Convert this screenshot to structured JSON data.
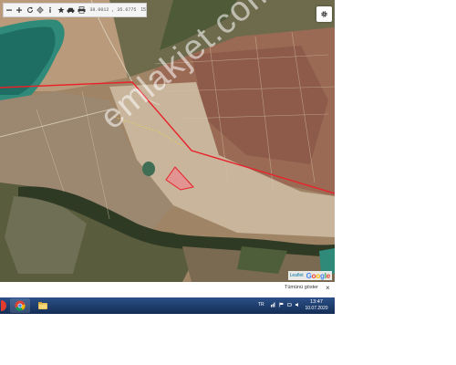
{
  "toolbar": {
    "coordinates": "38.0012 , 35.6775",
    "zoom": "15",
    "icons": [
      "zoom-out-icon",
      "zoom-in-icon",
      "refresh-icon",
      "crosshair-icon",
      "info-icon",
      "star-icon",
      "car-icon",
      "print-icon"
    ]
  },
  "watermark": "emlakjet.com",
  "attribution": {
    "leaflet": "Leaflet",
    "google": [
      "G",
      "o",
      "o",
      "g",
      "l",
      "e"
    ]
  },
  "bottom_bar": {
    "show_all": "Tümünü göster",
    "close": "×"
  },
  "taskbar": {
    "apps": [
      "start-icon",
      "chrome-icon",
      "windows-explorer-icon"
    ],
    "language": "TR",
    "time": "13:47",
    "date": "10.07.2020"
  },
  "colors": {
    "boundary": "#e8212a",
    "parcel_fill": "#e98a8f",
    "taskbar": "#1f3f73"
  }
}
